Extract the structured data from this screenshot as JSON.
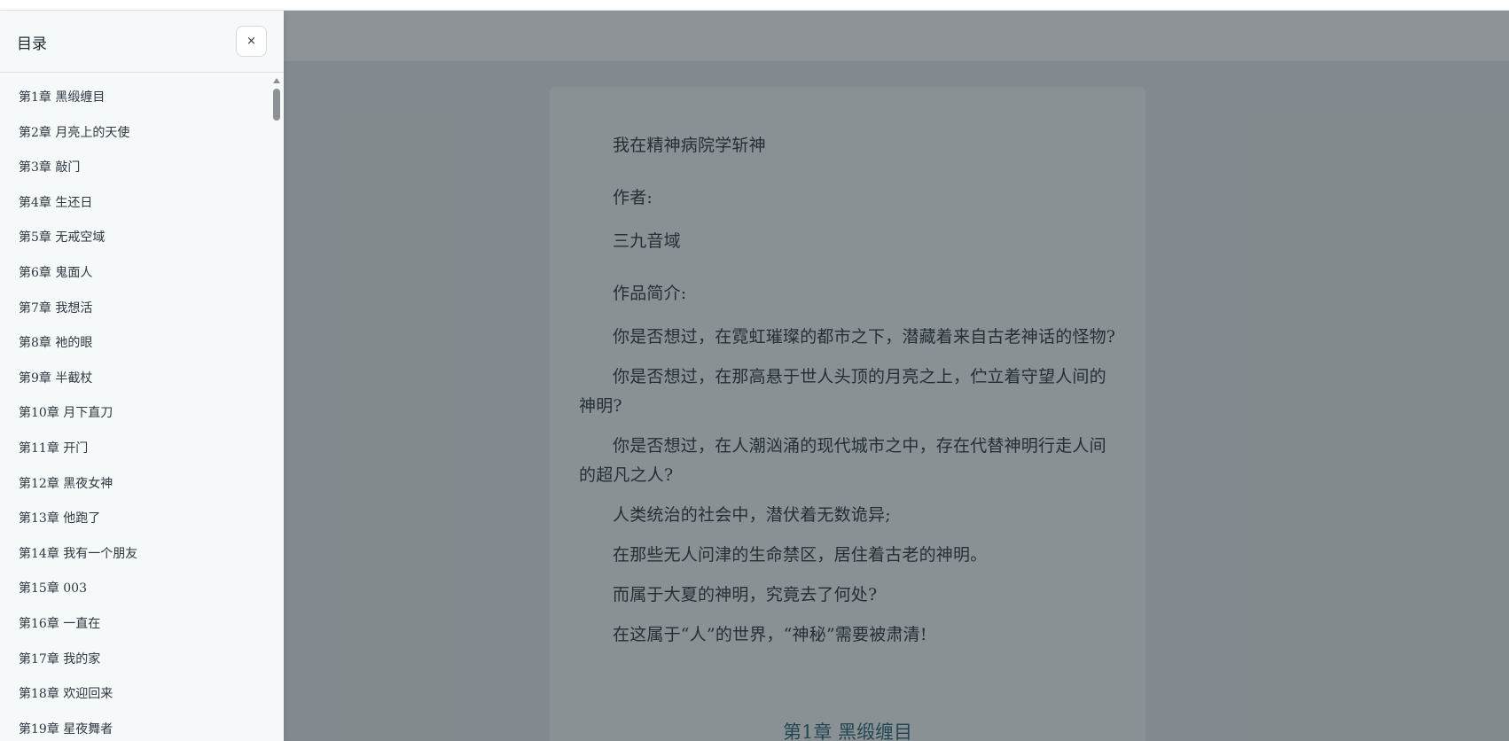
{
  "sidebar": {
    "title": "目录",
    "close_label": "×",
    "chapters": [
      "第1章 黑缎缠目",
      "第2章 月亮上的天使",
      "第3章 敲门",
      "第4章 生还日",
      "第5章 无戒空域",
      "第6章 鬼面人",
      "第7章 我想活",
      "第8章 祂的眼",
      "第9章 半截杖",
      "第10章 月下直刀",
      "第11章 开门",
      "第12章 黑夜女神",
      "第13章 他跑了",
      "第14章 我有一个朋友",
      "第15章 003",
      "第16章 一直在",
      "第17章 我的家",
      "第18章 欢迎回来",
      "第19章 星夜舞者"
    ]
  },
  "reader": {
    "book_title": "我在精神病院学斩神",
    "author_label": "作者:",
    "author": "三九音域",
    "intro_label": "作品简介:",
    "intro": [
      "你是否想过，在霓虹璀璨的都市之下，潜藏着来自古老神话的怪物?",
      "你是否想过，在那高悬于世人头顶的月亮之上，伫立着守望人间的神明?",
      "你是否想过，在人潮汹涌的现代城市之中，存在代替神明行走人间的超凡之人?",
      "人类统治的社会中，潜伏着无数诡异;",
      "在那些无人问津的生命禁区，居住着古老的神明。",
      "而属于大夏的神明，究竟去了何处?",
      "在这属于“人”的世界，“神秘”需要被肃清!"
    ],
    "chapter_heading": "第1章 黑缎缠目"
  }
}
